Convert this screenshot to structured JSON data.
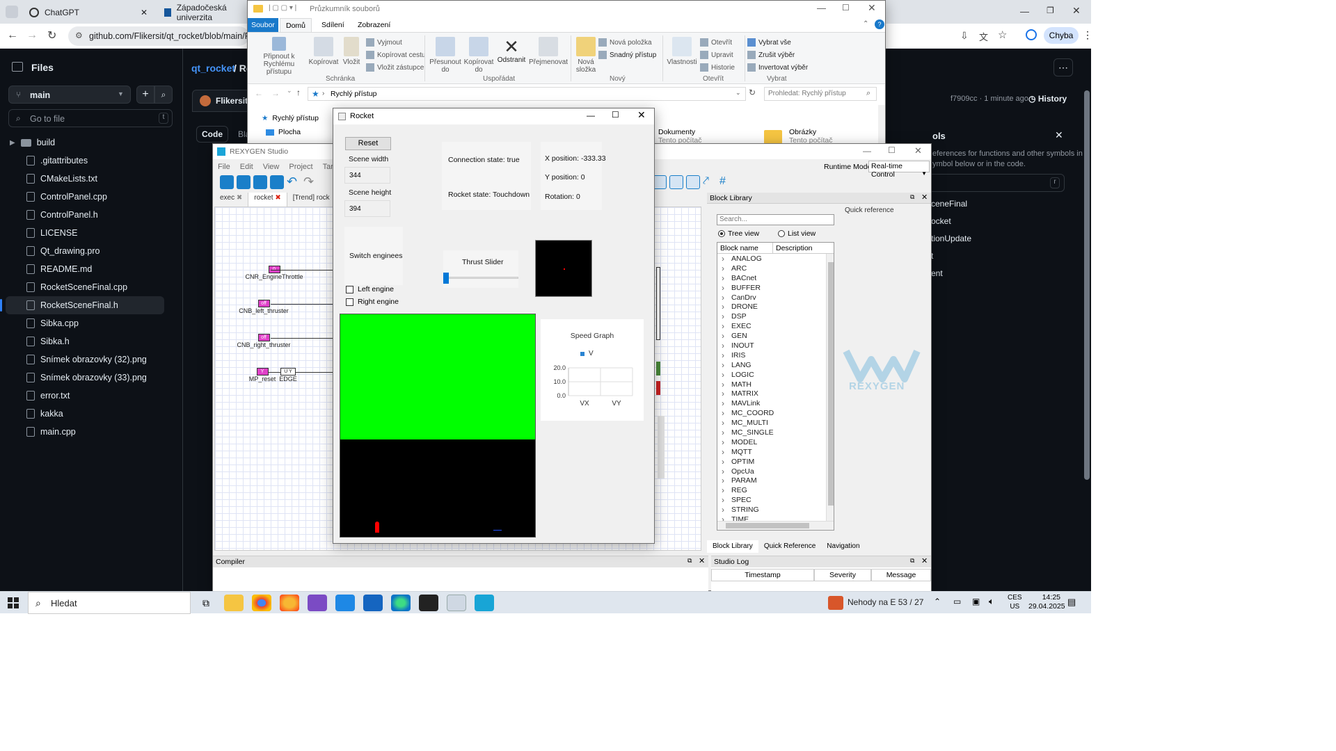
{
  "browser": {
    "tabs": [
      {
        "title": "ChatGPT"
      },
      {
        "title": "Západočeská univerzita"
      }
    ],
    "url": "github.com/Flikersit/qt_rocket/blob/main/Ro",
    "profile_label": "Chyba"
  },
  "github": {
    "sidebar_title": "Files",
    "branch": "main",
    "goto_placeholder": "Go to file",
    "goto_shortcut": "t",
    "files": [
      {
        "name": "build",
        "type": "folder"
      },
      {
        "name": ".gitattributes",
        "type": "file"
      },
      {
        "name": "CMakeLists.txt",
        "type": "file"
      },
      {
        "name": "ControlPanel.cpp",
        "type": "file"
      },
      {
        "name": "ControlPanel.h",
        "type": "file"
      },
      {
        "name": "LICENSE",
        "type": "file"
      },
      {
        "name": "Qt_drawing.pro",
        "type": "file"
      },
      {
        "name": "README.md",
        "type": "file"
      },
      {
        "name": "RocketSceneFinal.cpp",
        "type": "file"
      },
      {
        "name": "RocketSceneFinal.h",
        "type": "file"
      },
      {
        "name": "Sibka.cpp",
        "type": "file"
      },
      {
        "name": "Sibka.h",
        "type": "file"
      },
      {
        "name": "Snímek obrazovky (32).png",
        "type": "file"
      },
      {
        "name": "Snímek obrazovky (33).png",
        "type": "file"
      },
      {
        "name": "error.txt",
        "type": "file"
      },
      {
        "name": "kakka",
        "type": "file"
      },
      {
        "name": "main.cpp",
        "type": "file"
      }
    ],
    "breadcrumb_repo": "qt_rocket",
    "breadcrumb_sep": "/ Ro",
    "author": "Flikersit",
    "commit_info": "f7909cc · 1 minute ago",
    "history_label": "History",
    "code_tab": "Code",
    "blame_tab": "Bla",
    "symbols_title": "ols",
    "symbols_desc": "eferences for functions and other symbols in\nymbol below or in the code.",
    "symbols": [
      "ceneFinal",
      "ocket",
      "tionUpdate",
      "t",
      "ent"
    ]
  },
  "explorer": {
    "title": "Průzkumník souborů",
    "ribbon_tabs": [
      "Soubor",
      "Domů",
      "Sdílení",
      "Zobrazení"
    ],
    "groups": {
      "schranka": "Schránka",
      "usporadat": "Uspořádat",
      "novy": "Nový",
      "otevrit": "Otevřít",
      "vybrat": "Vybrat"
    },
    "buttons": {
      "pripnout": "Připnout k\nRychlému přístupu",
      "kopirovat": "Kopírovat",
      "vlozit": "Vložit",
      "vyjmout": "Vyjmout",
      "kopirovat_cestu": "Kopírovat cestu",
      "vlozit_zastupce": "Vložit zástupce",
      "presunout": "Přesunout\ndo",
      "kopirovat_do": "Kopírovat\ndo",
      "odstranit": "Odstranit",
      "prejmenovat": "Přejmenovat",
      "nova_slozka": "Nová\nsložka",
      "nova_polozka": "Nová položka",
      "snadny_pristup": "Snadný přístup",
      "vlastnosti": "Vlastnosti",
      "otevrit_btn": "Otevřít",
      "upravit": "Upravit",
      "historie": "Historie",
      "vybrat_vse": "Vybrat vše",
      "zrusit_vyber": "Zrušit výběr",
      "invertovat": "Invertovat výběr"
    },
    "path": "Rychlý přístup",
    "search_placeholder": "Prohledat: Rychlý přístup",
    "nav_items": [
      "Rychlý přístup",
      "Plocha"
    ],
    "folders": [
      {
        "name": "Dokumenty",
        "sub": "Tento počítač"
      },
      {
        "name": "Obrázky",
        "sub": "Tento počítač"
      }
    ]
  },
  "rexygen": {
    "title": "REXYGEN Studio",
    "menu": [
      "File",
      "Edit",
      "View",
      "Project",
      "Target"
    ],
    "runtime_mode_label": "Runtime Mode:",
    "runtime_mode_value": "Real-time Control",
    "tabs": [
      "exec",
      "rocket",
      "[Trend] rock"
    ],
    "blocks": [
      {
        "label": "CNR_EngineThrottle",
        "value": "0"
      },
      {
        "label": "CNB_left_thruster",
        "value": "off"
      },
      {
        "label": "CNB_right_thruster",
        "value": "off"
      },
      {
        "label": "MP_reset",
        "value": "Y"
      }
    ],
    "edge_block": {
      "label": "EDGE",
      "ports": "U  Y"
    },
    "block_library": {
      "title": "Block Library",
      "search_placeholder": "Search...",
      "quick_ref": "Quick reference",
      "view_tree": "Tree view",
      "view_list": "List view",
      "col_name": "Block name",
      "col_desc": "Description",
      "items": [
        "ANALOG",
        "ARC",
        "BACnet",
        "BUFFER",
        "CanDrv",
        "DRONE",
        "DSP",
        "EXEC",
        "GEN",
        "INOUT",
        "IRIS",
        "LANG",
        "LOGIC",
        "MATH",
        "MATRIX",
        "MAVLink",
        "MC_COORD",
        "MC_MULTI",
        "MC_SINGLE",
        "MODEL",
        "MQTT",
        "OPTIM",
        "OpcUa",
        "PARAM",
        "REG",
        "SPEC",
        "STRING",
        "TIME"
      ],
      "bottom_tabs": [
        "Block Library",
        "Quick Reference",
        "Navigation"
      ],
      "logo_text": "REXYGEN"
    },
    "compiler_title": "Compiler",
    "studio_log": {
      "title": "Studio Log",
      "cols": [
        "Timestamp",
        "Severity",
        "Message"
      ]
    }
  },
  "rocket": {
    "title": "Rocket",
    "reset_label": "Reset",
    "scene_width_label": "Scene width",
    "scene_width_value": "344",
    "scene_height_label": "Scene height",
    "scene_height_value": "394",
    "connection_state": "Connection state: true",
    "rocket_state": "Rocket state: Touchdown",
    "x_position": "X position: -333.33",
    "y_position": "Y position: 0",
    "rotation": "Rotation: 0",
    "switch_label": "Switch enginees",
    "thrust_label": "Thrust Slider",
    "thrust_level": 0.0,
    "left_engine": "Left engine",
    "right_engine": "Right engine",
    "colors": {
      "sky": "#00ff00",
      "ground": "#000000",
      "rocket": "#ff0000"
    }
  },
  "chart_data": {
    "type": "bar",
    "title": "Speed Graph",
    "categories": [
      "VX",
      "VY"
    ],
    "series": [
      {
        "name": "V",
        "values": [
          0,
          0
        ]
      }
    ],
    "yticks": [
      "20.0",
      "10.0",
      "0.0"
    ],
    "ylim": [
      0,
      20
    ]
  },
  "taskbar": {
    "search_placeholder": "Hledat",
    "weather": "Nehody na E 53 / 27",
    "lang_top": "CES",
    "lang_bottom": "US",
    "time": "14:25",
    "date": "29.04.2025"
  }
}
